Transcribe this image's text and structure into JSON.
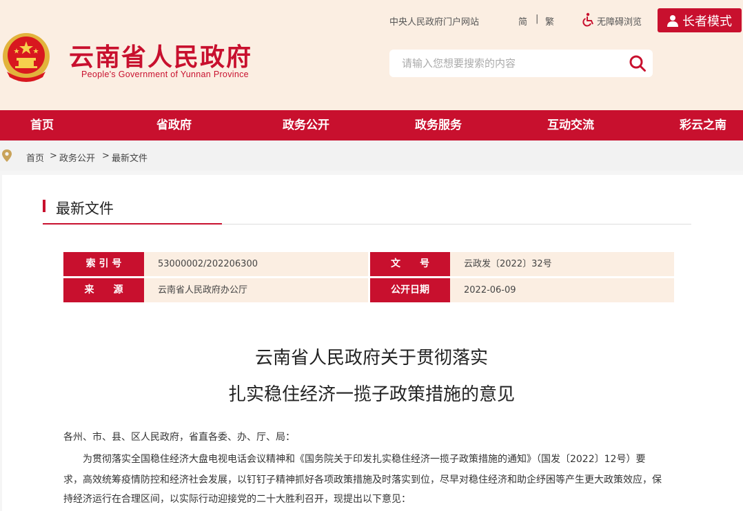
{
  "header": {
    "site_title": "云南省人民政府",
    "site_subtitle": "People's Government of Yunnan Province",
    "top_links": {
      "portal": "中央人民政府门户网站",
      "simplified": "简",
      "separator": "|",
      "traditional": "繁",
      "accessibility": "无障碍浏览"
    },
    "elder_mode": "长者模式",
    "search_placeholder": "请输入您想要搜索的内容"
  },
  "nav": [
    "首页",
    "省政府",
    "政务公开",
    "政务服务",
    "互动交流",
    "彩云之南"
  ],
  "breadcrumb": [
    "首页",
    ">",
    "政务公开",
    ">",
    "最新文件"
  ],
  "section_title": "最新文件",
  "meta": {
    "index_label": "索 引 号",
    "index_value": "53000002/202206300",
    "docno_label": "文　　号",
    "docno_value": "云政发〔2022〕32号",
    "source_label": "来　　源",
    "source_value": "云南省人民政府办公厅",
    "date_label": "公开日期",
    "date_value": "2022-06-09"
  },
  "document": {
    "title_line1": "云南省人民政府关于贯彻落实",
    "title_line2": "扎实稳住经济一揽子政策措施的意见",
    "salutation": "各州、市、县、区人民政府，省直各委、办、厅、局：",
    "body_line1": "为贯彻落实全国稳住经济大盘电视电话会议精神和《国务院关于印发扎实稳住经济一揽子政策措施的通知》（国发〔2022〕12号）要",
    "body_line2": "求，高效统筹疫情防控和经济社会发展，以钉钉子精神抓好各项政策措施及时落实到位，尽早对稳住经济和助企纾困等产生更大政策效应，保",
    "body_line3": "持经济运行在合理区间，以实际行动迎接党的二十大胜利召开，现提出以下意见："
  },
  "colors": {
    "brand_red": "#c8102e",
    "header_bg": "#fbeee2"
  }
}
